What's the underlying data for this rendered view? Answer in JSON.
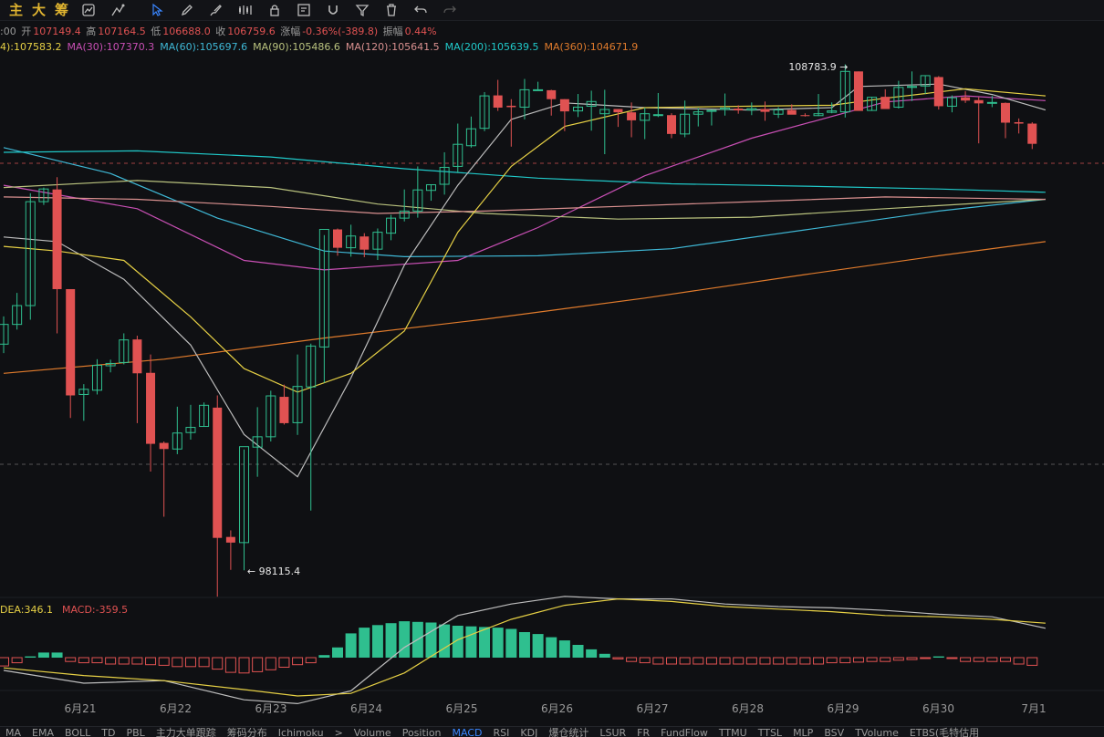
{
  "toolbar": {
    "labels": [
      "主",
      "大",
      "筹"
    ],
    "icons": [
      "chart-settings-icon",
      "indicator-icon",
      "cursor-icon",
      "pen-icon",
      "brush-icon",
      "pattern-icon",
      "lock-icon",
      "note-icon",
      "magnet-icon",
      "filter-icon",
      "delete-icon",
      "undo-icon",
      "redo-icon"
    ]
  },
  "ohlc": {
    "time": ":00",
    "open_label": "开",
    "open": "107149.4",
    "high_label": "高",
    "high": "107164.5",
    "low_label": "低",
    "low": "106688.0",
    "close_label": "收",
    "close": "106759.6",
    "change_label": "涨幅",
    "change": "-0.36%(-389.8)",
    "amp_label": "振幅",
    "amp": "0.44%"
  },
  "ma_legend": [
    {
      "text": "4):107583.2",
      "color": "#e6d045"
    },
    {
      "text": "MA(30):107370.3",
      "color": "#c84fb4"
    },
    {
      "text": "MA(60):105697.6",
      "color": "#3fb8d6"
    },
    {
      "text": "MA(90):105486.6",
      "color": "#b9c27e"
    },
    {
      "text": "MA(120):105641.5",
      "color": "#d9908f"
    },
    {
      "text": "MA(200):105639.5",
      "color": "#20c9c9"
    },
    {
      "text": "MA(360):104671.9",
      "color": "#e07b2c"
    }
  ],
  "macd_legend": [
    {
      "text": "DEA:346.1",
      "color": "#e6d045"
    },
    {
      "text": "MACD:-359.5",
      "color": "#e05252"
    }
  ],
  "chart_data": {
    "type": "candlestick",
    "x": [
      "6月21",
      "6月22",
      "6月23",
      "6月24",
      "6月25",
      "6月26",
      "6月27",
      "6月28",
      "6月29",
      "6月30",
      "7月1"
    ],
    "annotations": [
      {
        "text": "108783.9",
        "type": "high"
      },
      {
        "text": "98115.4",
        "type": "low"
      }
    ],
    "colors": {
      "up": "#2fbf8f",
      "down": "#e05252",
      "macd_neg": "#e05252",
      "macd_pos": "#2fbf8f"
    },
    "candles": [
      [
        102920,
        103510,
        102730,
        103340
      ],
      [
        103340,
        104010,
        103230,
        103740
      ],
      [
        103740,
        106130,
        103440,
        105950
      ],
      [
        105950,
        106250,
        105880,
        106220
      ],
      [
        106210,
        106470,
        103150,
        104090
      ],
      [
        104090,
        104090,
        101350,
        101830
      ],
      [
        101850,
        102070,
        101290,
        101960
      ],
      [
        101940,
        102600,
        101850,
        102470
      ],
      [
        102460,
        102590,
        102320,
        102510
      ],
      [
        102530,
        103150,
        102490,
        103010
      ],
      [
        103020,
        103100,
        101240,
        102300
      ],
      [
        102310,
        102700,
        100210,
        100800
      ],
      [
        100820,
        100850,
        99250,
        100690
      ],
      [
        100690,
        101590,
        100580,
        101030
      ],
      [
        101040,
        101630,
        100890,
        101150
      ],
      [
        101170,
        101680,
        101160,
        101620
      ],
      [
        101570,
        101830,
        97550,
        98800
      ],
      [
        98820,
        98960,
        98120,
        98700
      ],
      [
        98700,
        100680,
        98110,
        100740
      ],
      [
        100730,
        101580,
        100100,
        100950
      ],
      [
        100950,
        101930,
        100850,
        101820
      ],
      [
        101800,
        102060,
        101210,
        101240
      ],
      [
        101250,
        102700,
        100990,
        102020
      ],
      [
        102010,
        102930,
        99380,
        102880
      ],
      [
        102860,
        105240,
        102100,
        105360
      ],
      [
        105360,
        105380,
        104800,
        104970
      ],
      [
        104970,
        105460,
        104780,
        105220
      ],
      [
        105210,
        105280,
        104770,
        104930
      ],
      [
        104940,
        105380,
        104710,
        105300
      ],
      [
        105280,
        105670,
        105130,
        105600
      ],
      [
        105600,
        106210,
        105530,
        105750
      ],
      [
        105750,
        106700,
        105610,
        106200
      ],
      [
        106190,
        106320,
        105970,
        106310
      ],
      [
        106320,
        107000,
        106100,
        106680
      ],
      [
        106700,
        107610,
        106560,
        107170
      ],
      [
        107140,
        107760,
        107100,
        107500
      ],
      [
        107510,
        108280,
        107450,
        108200
      ],
      [
        108210,
        108540,
        107880,
        107950
      ],
      [
        107990,
        108130,
        107120,
        107960
      ],
      [
        107960,
        108560,
        107700,
        108330
      ],
      [
        108310,
        108500,
        108310,
        108330
      ],
      [
        108320,
        108330,
        107780,
        108130
      ],
      [
        108130,
        108130,
        107450,
        107870
      ],
      [
        107880,
        108240,
        107750,
        107960
      ],
      [
        107980,
        108310,
        107460,
        108080
      ],
      [
        107820,
        108330,
        106960,
        107910
      ],
      [
        107920,
        107920,
        107540,
        107850
      ],
      [
        107850,
        108060,
        107320,
        107680
      ],
      [
        107680,
        107950,
        107280,
        107820
      ],
      [
        107800,
        108260,
        107750,
        107800
      ],
      [
        107790,
        107830,
        107300,
        107390
      ],
      [
        107390,
        108100,
        107320,
        107810
      ],
      [
        107810,
        107940,
        107550,
        107860
      ],
      [
        107880,
        107910,
        107570,
        107890
      ],
      [
        107910,
        108250,
        107780,
        107940
      ],
      [
        107930,
        108000,
        107820,
        107890
      ],
      [
        107900,
        108060,
        107790,
        107930
      ],
      [
        107920,
        108080,
        107670,
        107860
      ],
      [
        107810,
        107960,
        107730,
        107900
      ],
      [
        107900,
        108020,
        107810,
        107800
      ],
      [
        107790,
        107830,
        107760,
        107770
      ],
      [
        107780,
        108240,
        107770,
        107820
      ],
      [
        107850,
        108060,
        107830,
        107880
      ],
      [
        107860,
        108870,
        107740,
        108720
      ],
      [
        108720,
        108720,
        107950,
        107880
      ],
      [
        107890,
        108180,
        107880,
        108170
      ],
      [
        108180,
        108340,
        107960,
        107920
      ],
      [
        107960,
        108520,
        107930,
        108380
      ],
      [
        108380,
        108720,
        108090,
        108400
      ],
      [
        108410,
        108630,
        108240,
        108630
      ],
      [
        108600,
        108620,
        107910,
        107980
      ],
      [
        107980,
        108210,
        107850,
        108160
      ],
      [
        108170,
        108300,
        108050,
        108100
      ],
      [
        108110,
        108170,
        107190,
        108040
      ],
      [
        108050,
        108200,
        107960,
        108060
      ],
      [
        108050,
        108060,
        107300,
        107630
      ],
      [
        107640,
        107720,
        107400,
        107610
      ],
      [
        107610,
        107640,
        107070,
        107180
      ]
    ],
    "ma_series": [
      {
        "name": "MA(30)",
        "color": "#c84fb4",
        "values": [
          [
            0,
            106300
          ],
          [
            10,
            105800
          ],
          [
            18,
            104700
          ],
          [
            24,
            104500
          ],
          [
            34,
            104700
          ],
          [
            40,
            105400
          ],
          [
            48,
            106500
          ],
          [
            56,
            107300
          ],
          [
            66,
            108070
          ],
          [
            72,
            108200
          ],
          [
            78,
            108100
          ]
        ]
      },
      {
        "name": "MA(60)",
        "color": "#3fb8d6",
        "values": [
          [
            0,
            107100
          ],
          [
            8,
            106550
          ],
          [
            16,
            105600
          ],
          [
            24,
            104900
          ],
          [
            30,
            104780
          ],
          [
            40,
            104800
          ],
          [
            50,
            104950
          ],
          [
            60,
            105350
          ],
          [
            70,
            105750
          ],
          [
            78,
            106000
          ]
        ]
      },
      {
        "name": "MA(90)",
        "color": "#b9c27e",
        "values": [
          [
            0,
            106250
          ],
          [
            10,
            106400
          ],
          [
            20,
            106250
          ],
          [
            28,
            105900
          ],
          [
            36,
            105700
          ],
          [
            46,
            105580
          ],
          [
            56,
            105620
          ],
          [
            66,
            105800
          ],
          [
            78,
            106000
          ]
        ]
      },
      {
        "name": "MA(120)",
        "color": "#d9908f",
        "values": [
          [
            0,
            106050
          ],
          [
            10,
            106000
          ],
          [
            20,
            105850
          ],
          [
            28,
            105700
          ],
          [
            36,
            105750
          ],
          [
            46,
            105850
          ],
          [
            56,
            105950
          ],
          [
            66,
            106050
          ],
          [
            78,
            106000
          ]
        ]
      },
      {
        "name": "MA(200)",
        "color": "#20c9c9",
        "values": [
          [
            0,
            107000
          ],
          [
            10,
            107030
          ],
          [
            20,
            106900
          ],
          [
            30,
            106650
          ],
          [
            40,
            106450
          ],
          [
            50,
            106330
          ],
          [
            60,
            106280
          ],
          [
            70,
            106220
          ],
          [
            78,
            106150
          ]
        ]
      },
      {
        "name": "MA(360)",
        "color": "#e07b2c",
        "values": [
          [
            0,
            102300
          ],
          [
            12,
            102600
          ],
          [
            24,
            103050
          ],
          [
            36,
            103450
          ],
          [
            48,
            103900
          ],
          [
            60,
            104400
          ],
          [
            70,
            104800
          ],
          [
            78,
            105100
          ]
        ]
      },
      {
        "name": "MA(7)",
        "color": "#bdbdbd",
        "values": [
          [
            0,
            105200
          ],
          [
            4,
            105100
          ],
          [
            9,
            104300
          ],
          [
            14,
            102900
          ],
          [
            18,
            101000
          ],
          [
            22,
            100100
          ],
          [
            26,
            102200
          ],
          [
            30,
            104600
          ],
          [
            34,
            106300
          ],
          [
            38,
            107700
          ],
          [
            42,
            108050
          ],
          [
            48,
            107950
          ],
          [
            56,
            107900
          ],
          [
            62,
            107950
          ],
          [
            64,
            108400
          ],
          [
            70,
            108450
          ],
          [
            74,
            108230
          ],
          [
            78,
            107900
          ]
        ]
      },
      {
        "name": "MA(14)",
        "color": "#e6d045",
        "values": [
          [
            0,
            105000
          ],
          [
            4,
            104900
          ],
          [
            9,
            104700
          ],
          [
            14,
            103500
          ],
          [
            18,
            102400
          ],
          [
            22,
            101900
          ],
          [
            26,
            102300
          ],
          [
            30,
            103200
          ],
          [
            34,
            105300
          ],
          [
            38,
            106700
          ],
          [
            42,
            107550
          ],
          [
            48,
            107950
          ],
          [
            56,
            107980
          ],
          [
            62,
            108000
          ],
          [
            66,
            108150
          ],
          [
            72,
            108350
          ],
          [
            78,
            108200
          ]
        ]
      }
    ],
    "macd": {
      "hist": [
        -65,
        -40,
        10,
        40,
        40,
        -30,
        -40,
        -40,
        -50,
        -50,
        -50,
        -55,
        -60,
        -70,
        -70,
        -70,
        -90,
        -115,
        -120,
        -110,
        -95,
        -75,
        -55,
        -40,
        20,
        80,
        190,
        235,
        255,
        270,
        285,
        280,
        275,
        260,
        250,
        245,
        240,
        235,
        225,
        200,
        185,
        160,
        135,
        100,
        65,
        30,
        -10,
        -30,
        -40,
        -50,
        -50,
        -50,
        -50,
        -50,
        -50,
        -50,
        -50,
        -50,
        -50,
        -50,
        -50,
        -50,
        -40,
        -40,
        -35,
        -30,
        -30,
        -20,
        -15,
        -5,
        10,
        -5,
        -30,
        -30,
        -30,
        -30,
        -50,
        -60
      ],
      "dif": [
        [
          0,
          -100
        ],
        [
          6,
          -200
        ],
        [
          12,
          -180
        ],
        [
          18,
          -330
        ],
        [
          22,
          -360
        ],
        [
          26,
          -260
        ],
        [
          30,
          80
        ],
        [
          34,
          330
        ],
        [
          38,
          420
        ],
        [
          42,
          480
        ],
        [
          46,
          460
        ],
        [
          50,
          460
        ],
        [
          54,
          420
        ],
        [
          58,
          400
        ],
        [
          62,
          390
        ],
        [
          66,
          370
        ],
        [
          70,
          340
        ],
        [
          74,
          320
        ],
        [
          78,
          230
        ]
      ],
      "dea": [
        [
          0,
          -80
        ],
        [
          6,
          -140
        ],
        [
          12,
          -180
        ],
        [
          18,
          -250
        ],
        [
          22,
          -300
        ],
        [
          26,
          -280
        ],
        [
          30,
          -120
        ],
        [
          34,
          140
        ],
        [
          38,
          300
        ],
        [
          42,
          410
        ],
        [
          46,
          460
        ],
        [
          50,
          440
        ],
        [
          54,
          400
        ],
        [
          58,
          380
        ],
        [
          62,
          360
        ],
        [
          66,
          330
        ],
        [
          70,
          320
        ],
        [
          74,
          300
        ],
        [
          78,
          270
        ]
      ]
    }
  },
  "bottom_tabs": [
    "MA",
    "EMA",
    "BOLL",
    "TD",
    "PBL",
    "主力大单跟踪",
    "筹码分布",
    "Ichimoku",
    ">",
    "Volume",
    "Position",
    "MACD",
    "RSI",
    "KDJ",
    "爆仓统计",
    "LSUR",
    "FR",
    "FundFlow",
    "TTMU",
    "TTSL",
    "MLP",
    "BSV",
    "TVolume",
    "ETBS(毛特估用"
  ],
  "bottom_active": "MACD"
}
